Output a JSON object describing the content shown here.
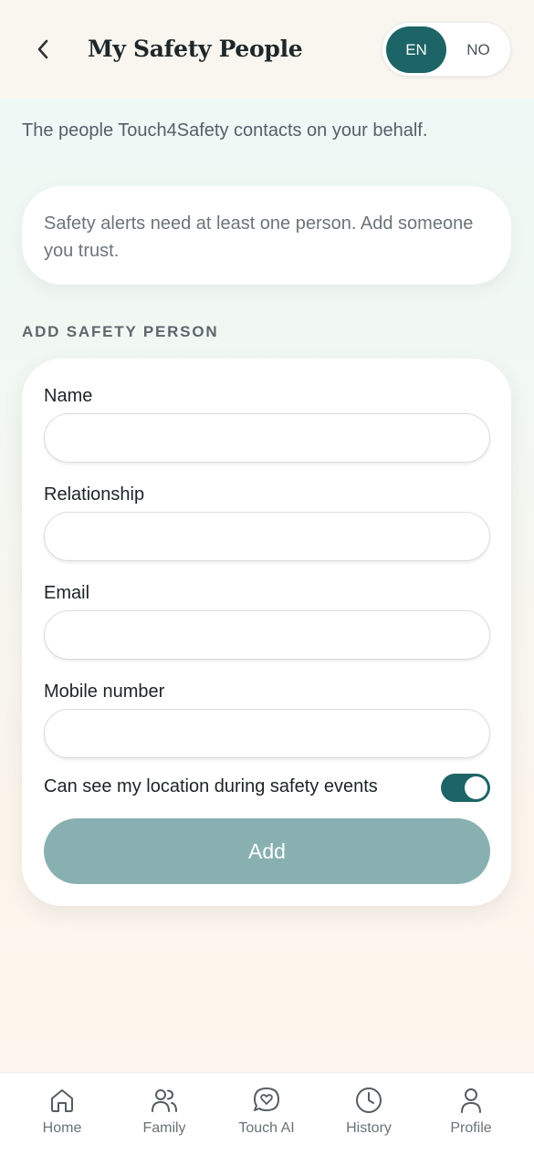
{
  "header": {
    "title": "My Safety People",
    "back_icon": "chevron-left-icon",
    "language": {
      "options": [
        "EN",
        "NO"
      ],
      "selected": "EN"
    }
  },
  "subtitle": "The people Touch4Safety contacts on your behalf.",
  "notice": "Safety alerts need at least one person. Add someone you trust.",
  "section_label": "ADD SAFETY PERSON",
  "form": {
    "name_label": "Name",
    "name_value": "",
    "relationship_label": "Relationship",
    "relationship_value": "",
    "email_label": "Email",
    "email_value": "",
    "mobile_label": "Mobile number",
    "mobile_value": "",
    "location_toggle_label": "Can see my location during safety events",
    "location_toggle_on": true,
    "add_label": "Add"
  },
  "nav": {
    "items": [
      {
        "label": "Home",
        "icon": "home-icon"
      },
      {
        "label": "Family",
        "icon": "users-icon"
      },
      {
        "label": "Touch AI",
        "icon": "chat-heart-icon"
      },
      {
        "label": "History",
        "icon": "clock-icon"
      },
      {
        "label": "Profile",
        "icon": "user-icon"
      }
    ]
  },
  "colors": {
    "accent": "#1d6466",
    "button_disabled": "#89b0b0",
    "nav_icon": "#555d61"
  }
}
